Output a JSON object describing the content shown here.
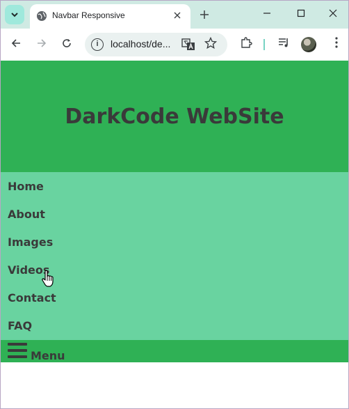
{
  "browser": {
    "tab_title": "Navbar Responsive",
    "url": "localhost/de...",
    "icons": {
      "tab_search": "chevron-down-icon",
      "favicon": "globe-icon",
      "close": "close-icon",
      "new_tab": "plus-icon",
      "minimize": "minimize-icon",
      "maximize": "maximize-icon",
      "window_close": "window-close-icon",
      "back": "back-arrow-icon",
      "forward": "forward-arrow-icon",
      "reload": "reload-icon",
      "site_info": "info-icon",
      "translate": "translate-icon",
      "bookmark": "star-icon",
      "extensions": "puzzle-icon",
      "media": "media-queue-icon",
      "profile": "avatar-icon",
      "more": "more-vert-icon"
    }
  },
  "site": {
    "title": "DarkCode WebSite",
    "nav_items": [
      "Home",
      "About",
      "Images",
      "Videos",
      "Contact",
      "FAQ"
    ],
    "menu_label": "Menu"
  },
  "colors": {
    "header_bg": "#2fb155",
    "nav_bg": "#69d3a0",
    "text": "#3a3a3a",
    "tabstrip_bg": "#cfeae3"
  }
}
